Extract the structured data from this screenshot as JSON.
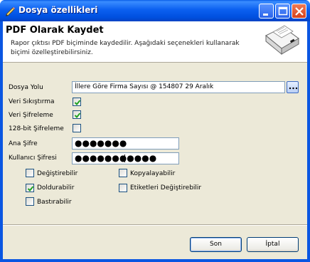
{
  "window": {
    "title": "Dosya özellikleri"
  },
  "header": {
    "title": "PDF Olarak Kaydet",
    "description": "Rapor çıktısı PDF biçiminde kaydedilir. Aşağıdaki seçenekleri kullanarak biçimi özelleştirebilirsiniz."
  },
  "form": {
    "file_path": {
      "label": "Dosya Yolu",
      "value": "İllere Göre Firma Sayısı @ 154807 29 Aralık",
      "browse_label": "..."
    },
    "compress": {
      "label": "Veri Sıkıştırma",
      "checked": true
    },
    "encrypt": {
      "label": "Veri Şifreleme",
      "checked": true
    },
    "encrypt128": {
      "label": "128-bit Şifreleme",
      "checked": false
    },
    "master_password": {
      "label": "Ana Şifre",
      "value": "●●●●●●●"
    },
    "user_password": {
      "label": "Kullanıcı Şifresi",
      "value": "●●●●●●●●●●●"
    },
    "permissions": [
      {
        "label": "Değiştirebilir",
        "checked": false
      },
      {
        "label": "Kopyalayabilir",
        "checked": false
      },
      {
        "label": "Doldurabilir",
        "checked": true
      },
      {
        "label": "Etiketleri Değiştirebilir",
        "checked": false
      },
      {
        "label": "Bastırabilir",
        "checked": false
      }
    ]
  },
  "buttons": {
    "ok": "Son",
    "cancel": "İptal"
  },
  "colors": {
    "titlebar": "#0a5ee8",
    "face": "#ece9d8",
    "check": "#21a121",
    "close": "#d6431c"
  }
}
